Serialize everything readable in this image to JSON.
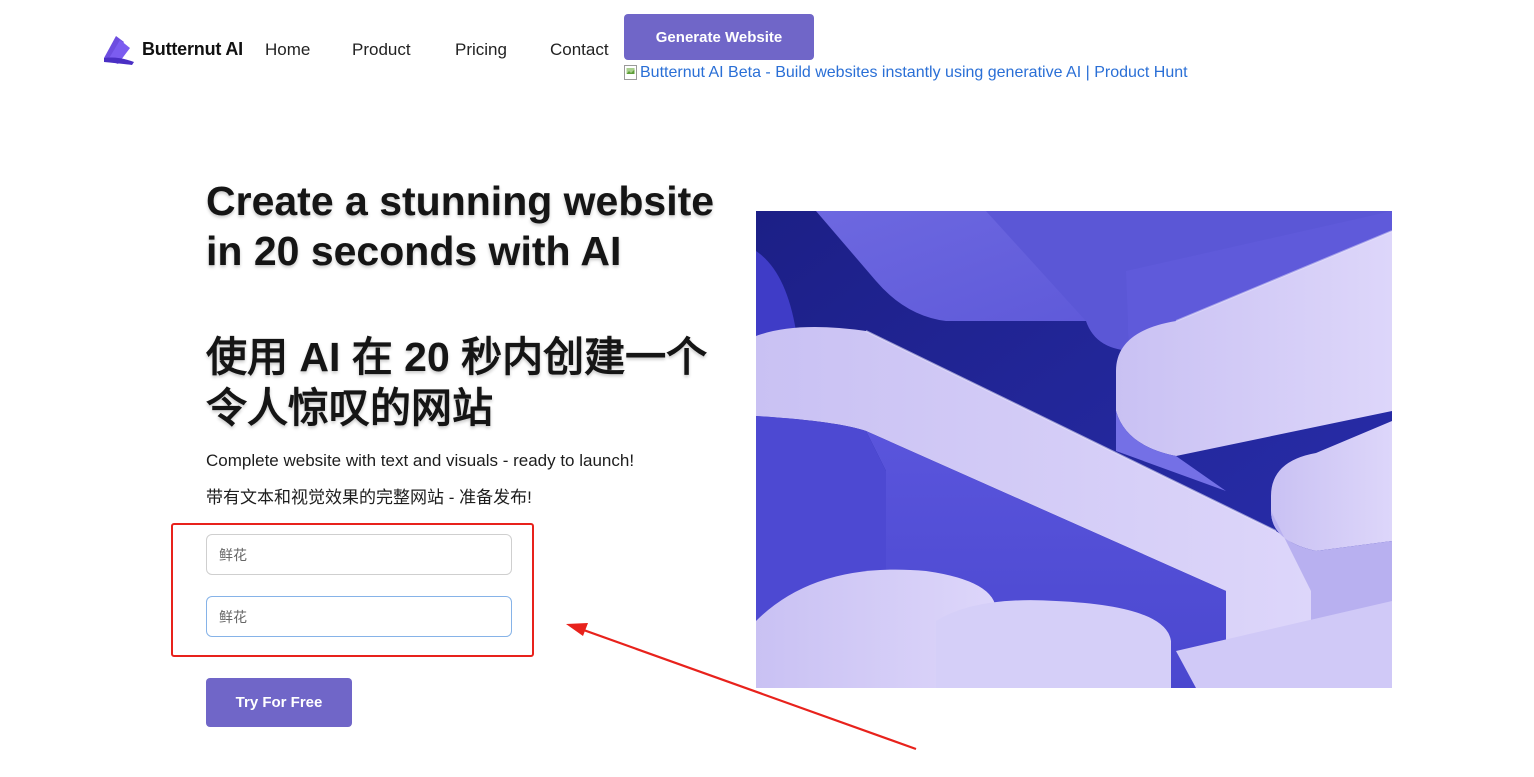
{
  "brand": {
    "name": "Butternut AI"
  },
  "nav": {
    "items": [
      {
        "label": "Home"
      },
      {
        "label": "Product"
      },
      {
        "label": "Pricing"
      },
      {
        "label": "Contact"
      }
    ],
    "cta_label": "Generate Website",
    "product_hunt_alt": "Butternut AI Beta - Build websites instantly using generative AI | Product Hunt"
  },
  "hero": {
    "title_en": "Create a stunning website in 20 seconds with AI",
    "title_zh": "使用 AI 在 20 秒内创建一个令人惊叹的网站",
    "subtitle_en": "Complete website with text and visuals - ready to launch!",
    "subtitle_zh": "带有文本和视觉效果的完整网站 - 准备发布!",
    "fields": [
      {
        "placeholder": "鲜花"
      },
      {
        "placeholder": "鲜花"
      }
    ],
    "try_label": "Try For Free"
  },
  "colors": {
    "accent": "#7066c8",
    "link": "#2a6fd6",
    "annotation": "#e8221c"
  },
  "icons": [
    "logo-icon",
    "broken-image-icon",
    "annotation-arrow"
  ]
}
